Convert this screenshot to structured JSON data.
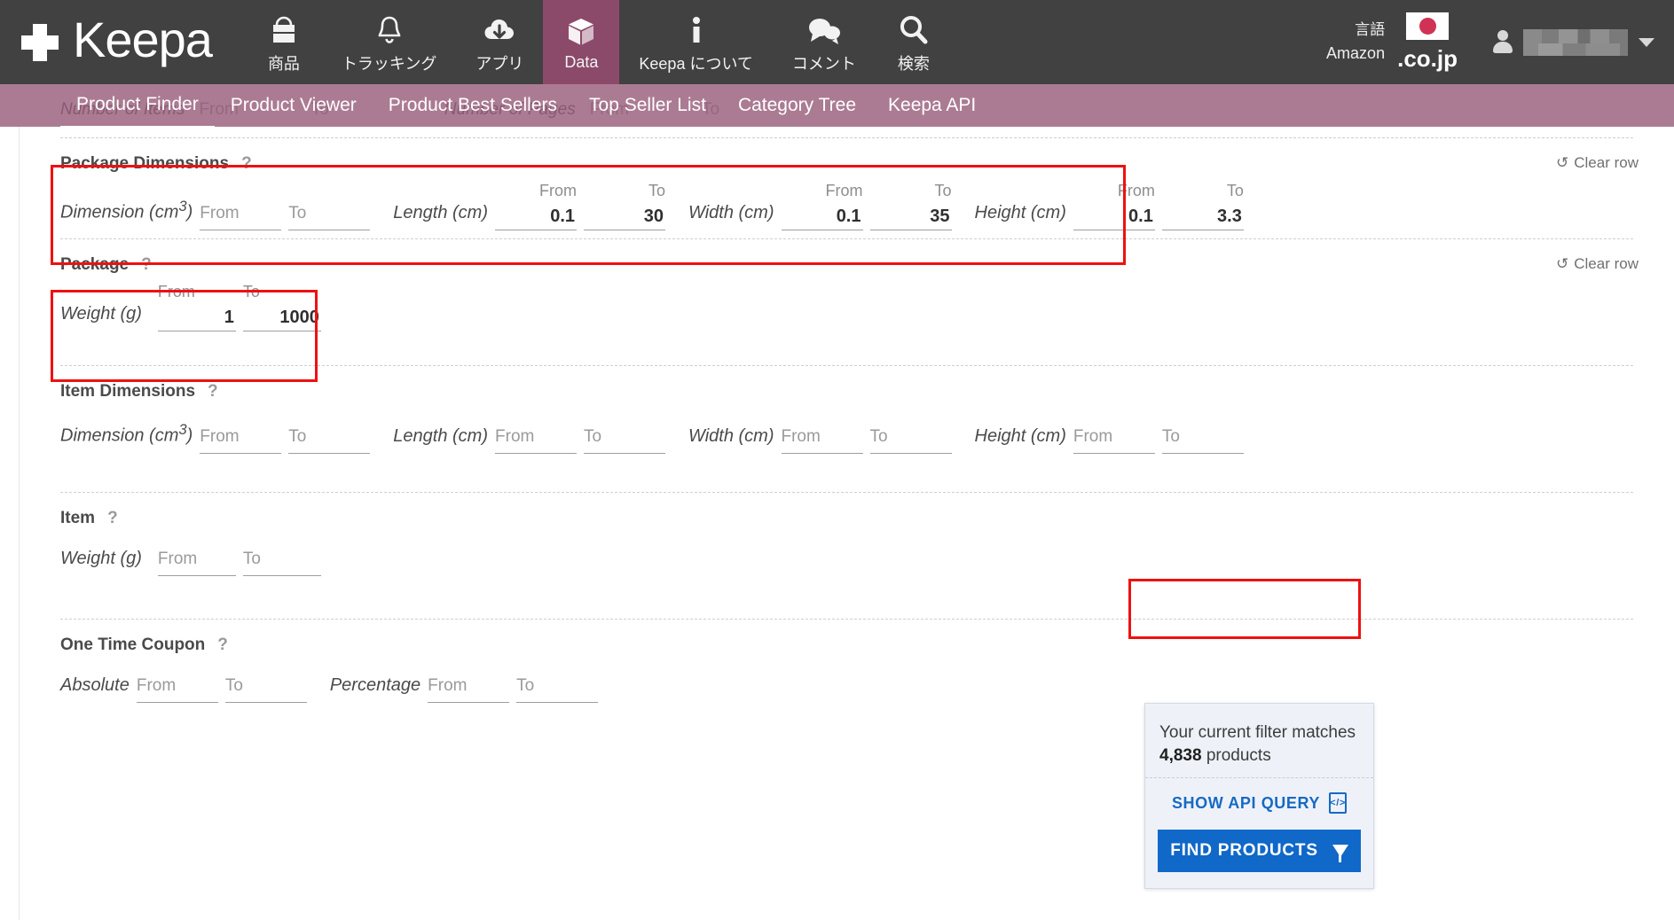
{
  "header": {
    "brand": "Keepa",
    "nav_items": [
      {
        "label": "商品",
        "icon": "shopping-bag-icon",
        "active": false
      },
      {
        "label": "トラッキング",
        "icon": "bell-icon",
        "active": false
      },
      {
        "label": "アプリ",
        "icon": "cloud-download-icon",
        "active": false
      },
      {
        "label": "Data",
        "icon": "box-icon",
        "active": true
      },
      {
        "label": "Keepa について",
        "icon": "info-icon",
        "active": false
      },
      {
        "label": "コメント",
        "icon": "comment-icon",
        "active": false
      },
      {
        "label": "検索",
        "icon": "search-icon",
        "active": false
      }
    ],
    "language_label": "言語",
    "amazon_label": "Amazon",
    "domain": ".co.jp",
    "flag": "japan-flag"
  },
  "subnav": {
    "items": [
      {
        "label": "Product Finder",
        "current": true
      },
      {
        "label": "Product Viewer",
        "current": false
      },
      {
        "label": "Product Best Sellers",
        "current": false
      },
      {
        "label": "Top Seller List",
        "current": false
      },
      {
        "label": "Category Tree",
        "current": false
      },
      {
        "label": "Keepa API",
        "current": false
      }
    ]
  },
  "ghost_row": {
    "label_1": "Number of Items",
    "from_1": "From",
    "to_1": "To",
    "label_2": "Number of Pages",
    "from_2": "From",
    "to_2": "To"
  },
  "clear_row_label": "Clear row",
  "clear_row_icon": "↺",
  "help_icon": "?",
  "placeholders": {
    "from": "From",
    "to": "To"
  },
  "filters": [
    {
      "title": "Package Dimensions",
      "highlighted": true,
      "clear_row": true,
      "groups": [
        {
          "label": "Dimension (cm³)",
          "from": "",
          "to": ""
        },
        {
          "label": "Length (cm)",
          "from": "0.1",
          "to": "30"
        },
        {
          "label": "Width (cm)",
          "from": "0.1",
          "to": "35"
        },
        {
          "label": "Height (cm)",
          "from": "0.1",
          "to": "3.3"
        }
      ]
    },
    {
      "title": "Package",
      "highlighted": true,
      "clear_row": true,
      "groups": [
        {
          "label": "Weight (g)",
          "from": "1",
          "to": "1000"
        }
      ]
    },
    {
      "title": "Item Dimensions",
      "highlighted": false,
      "clear_row": false,
      "groups": [
        {
          "label": "Dimension (cm³)",
          "from": "",
          "to": ""
        },
        {
          "label": "Length (cm)",
          "from": "",
          "to": ""
        },
        {
          "label": "Width (cm)",
          "from": "",
          "to": ""
        },
        {
          "label": "Height (cm)",
          "from": "",
          "to": ""
        }
      ]
    },
    {
      "title": "Item",
      "highlighted": false,
      "clear_row": false,
      "groups": [
        {
          "label": "Weight (g)",
          "from": "",
          "to": ""
        }
      ]
    },
    {
      "title": "One Time Coupon",
      "highlighted": false,
      "clear_row": false,
      "groups": [
        {
          "label": "Absolute",
          "from": "",
          "to": ""
        },
        {
          "label": "Percentage",
          "from": "",
          "to": ""
        }
      ]
    }
  ],
  "results": {
    "match_prefix": "Your current filter matches",
    "match_count": "4,838",
    "match_suffix": "products",
    "api_query_label": "SHOW API QUERY",
    "find_button_label": "FIND PRODUCTS",
    "accent_color": "#1068c8"
  }
}
